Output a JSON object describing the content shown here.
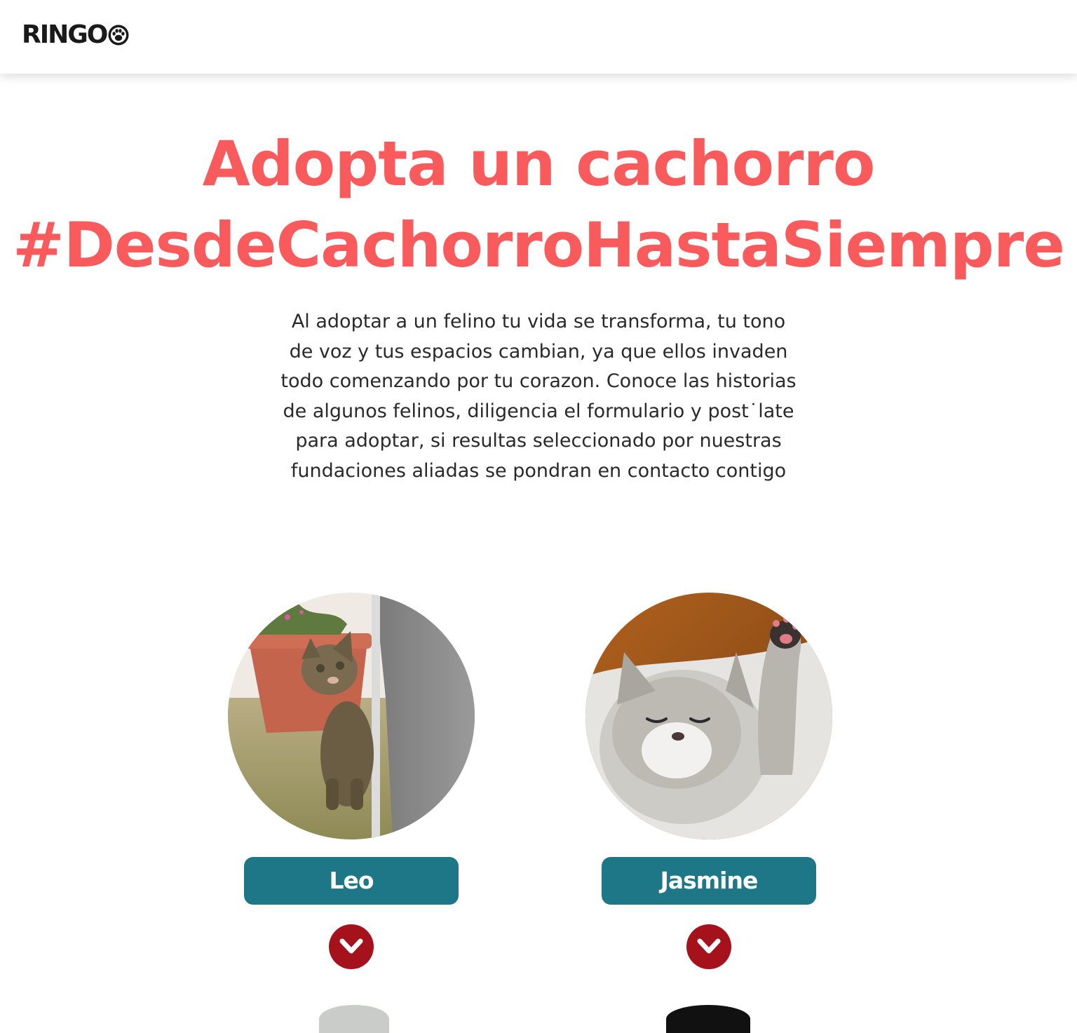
{
  "header": {
    "logo_text": "RINGO",
    "logo_icon": "paw-icon"
  },
  "hero": {
    "title_line1": "Adopta un cachorro",
    "title_line2": "#DesdeCachorroHastaSiempre",
    "intro": "Al adoptar a un felino tu vida se transforma, tu tono de voz y tus espacios cambian, ya que ellos invaden todo comenzando por tu corazon. Conoce las historias de algunos felinos, diligencia el formulario y post˙late para adoptar, si resultas seleccionado por nuestras fundaciones aliadas se pondran en contacto contigo"
  },
  "cats": [
    {
      "name": "Leo",
      "toggle_icon": "chevron-down-icon"
    },
    {
      "name": "Jasmine",
      "toggle_icon": "chevron-down-icon"
    }
  ],
  "colors": {
    "accent": "#f95a5b",
    "button": "#1e7787",
    "toggle": "#a5121c",
    "text": "#2a2a2a"
  }
}
